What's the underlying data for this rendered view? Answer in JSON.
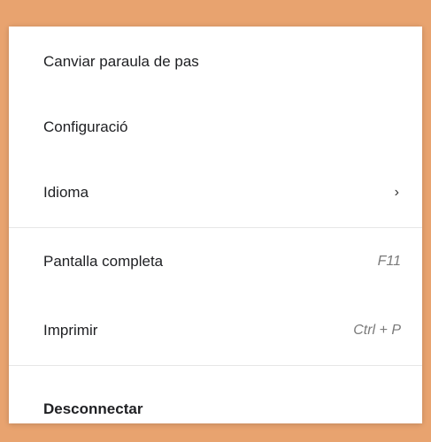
{
  "menu": {
    "items": [
      {
        "label": "Canviar paraula de pas",
        "shortcut": ""
      },
      {
        "label": "Configuració",
        "shortcut": ""
      },
      {
        "label": "Idioma",
        "submenu_indicator": "›"
      },
      {
        "label": "Pantalla completa",
        "shortcut": "F11"
      },
      {
        "label": "Imprimir",
        "shortcut": "Ctrl + P"
      },
      {
        "label": "Desconnectar",
        "shortcut": ""
      }
    ]
  },
  "colors": {
    "background_accent": "#e8a36f",
    "menu_bg": "#ffffff",
    "text": "#202124",
    "shortcut_text": "#7a7a7a",
    "divider": "#e6e6e6"
  },
  "icons": {
    "submenu": "chevron-right-icon"
  }
}
